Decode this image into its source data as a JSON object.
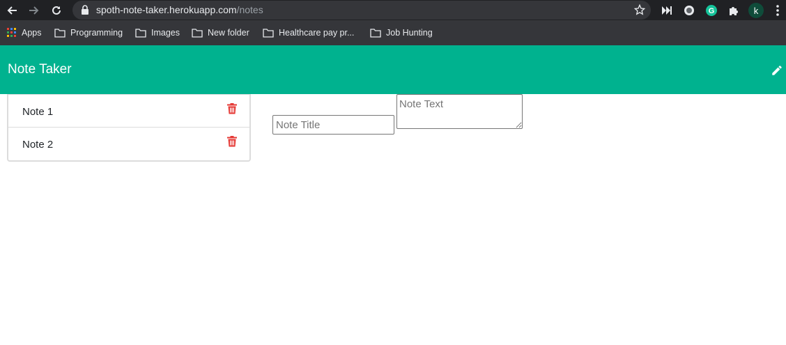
{
  "browser": {
    "url_host": "spoth-note-taker.herokuapp.com",
    "url_path": "/notes",
    "profile_initial": "k",
    "bookmarks": [
      {
        "label": "Apps",
        "icon": "apps-grid-icon"
      },
      {
        "label": "Programming",
        "icon": "folder-icon"
      },
      {
        "label": "Images",
        "icon": "folder-icon"
      },
      {
        "label": "New folder",
        "icon": "folder-icon"
      },
      {
        "label": "Healthcare pay pr...",
        "icon": "folder-icon"
      },
      {
        "label": "Job Hunting",
        "icon": "folder-icon"
      }
    ]
  },
  "app": {
    "brand": "Note Taker",
    "new_note_icon": "pencil-icon",
    "accent_color": "#00b28f",
    "delete_color": "#e53935",
    "notes": [
      {
        "title": "Note 1"
      },
      {
        "title": "Note 2"
      }
    ],
    "editor": {
      "title_placeholder": "Note Title",
      "text_placeholder": "Note Text"
    }
  }
}
